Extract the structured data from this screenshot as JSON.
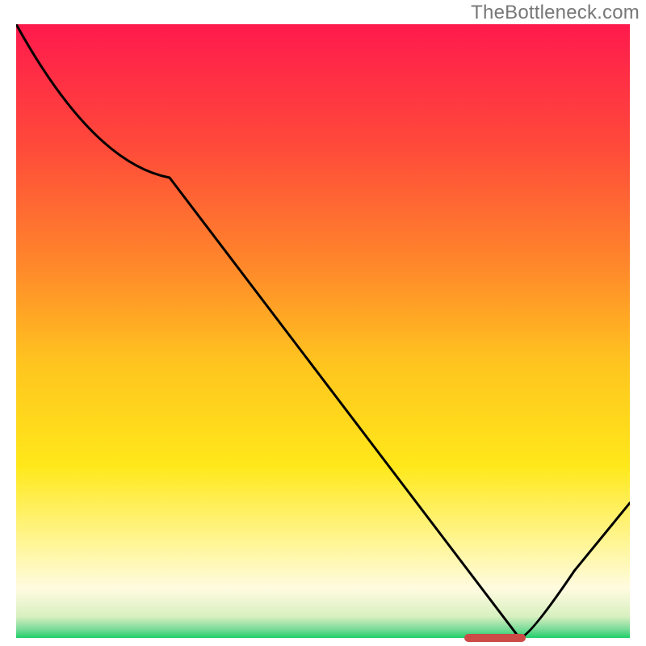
{
  "watermark": "TheBottleneck.com",
  "chart_data": {
    "type": "line",
    "title": "",
    "xlabel": "",
    "ylabel": "",
    "xlim": [
      0,
      100
    ],
    "ylim": [
      0,
      100
    ],
    "series": [
      {
        "name": "curve",
        "x": [
          0,
          25,
          82,
          100
        ],
        "y": [
          100,
          75,
          0,
          22
        ]
      }
    ],
    "marker": {
      "x_start": 73,
      "x_end": 83,
      "y": 0
    },
    "gradient_stops": [
      {
        "offset": 0.0,
        "color": "#ff1a4d"
      },
      {
        "offset": 0.2,
        "color": "#ff4a3a"
      },
      {
        "offset": 0.4,
        "color": "#ff8a2a"
      },
      {
        "offset": 0.55,
        "color": "#ffc41f"
      },
      {
        "offset": 0.72,
        "color": "#ffe81a"
      },
      {
        "offset": 0.85,
        "color": "#fff69a"
      },
      {
        "offset": 0.92,
        "color": "#fffbe0"
      },
      {
        "offset": 0.965,
        "color": "#d8f0c0"
      },
      {
        "offset": 0.985,
        "color": "#7edc9a"
      },
      {
        "offset": 1.0,
        "color": "#1fcf6a"
      }
    ]
  }
}
